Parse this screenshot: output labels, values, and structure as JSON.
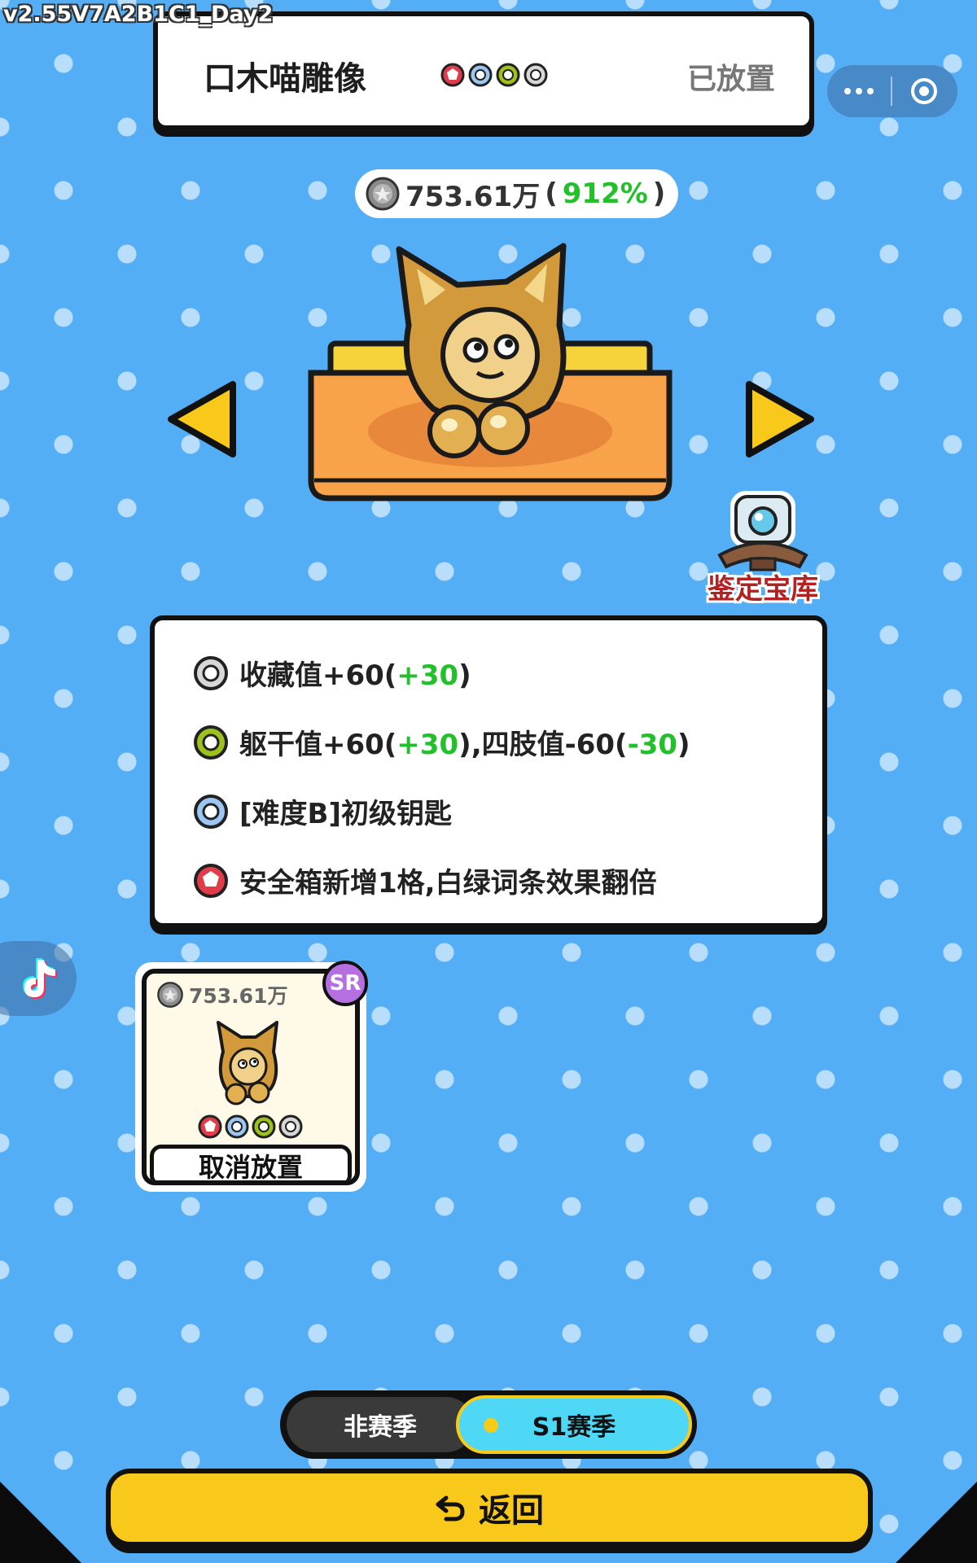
{
  "version": "v2.55V7A2B1C1_Day2",
  "header": {
    "item_name": "口木喵雕像",
    "status": "已放置"
  },
  "value_display": {
    "amount": "753.61万",
    "open_paren": "(",
    "percent": "912%",
    "close_paren": ")"
  },
  "vault": {
    "label": "鉴定宝库"
  },
  "effects": [
    {
      "icon": "white-ring",
      "prefix": "收藏值+60(",
      "bonus": "+30",
      "suffix": ")"
    },
    {
      "icon": "green-ring",
      "prefix": "躯干值+60(",
      "bonus": "+30",
      "middle": "),四肢值-60(",
      "bonus2": "-30",
      "suffix": ")"
    },
    {
      "icon": "blue-ring",
      "text": "[难度B]初级钥匙"
    },
    {
      "icon": "red-pentagon",
      "text": "安全箱新增1格,白绿词条效果翻倍"
    }
  ],
  "item_card": {
    "value": "753.61万",
    "rarity": "SR",
    "cancel_label": "取消放置"
  },
  "season_toggle": {
    "off_label": "非赛季",
    "on_label": "S1赛季"
  },
  "back_button": {
    "label": "返回",
    "icon": "return-arrow-icon"
  },
  "colors": {
    "background": "#54AEF6",
    "bonus_green": "#22c02a",
    "back_button": "#F8C91A",
    "season_active": "#4FD8F5",
    "sr_badge": "#B66FE0",
    "vault_label": "#B22222"
  }
}
